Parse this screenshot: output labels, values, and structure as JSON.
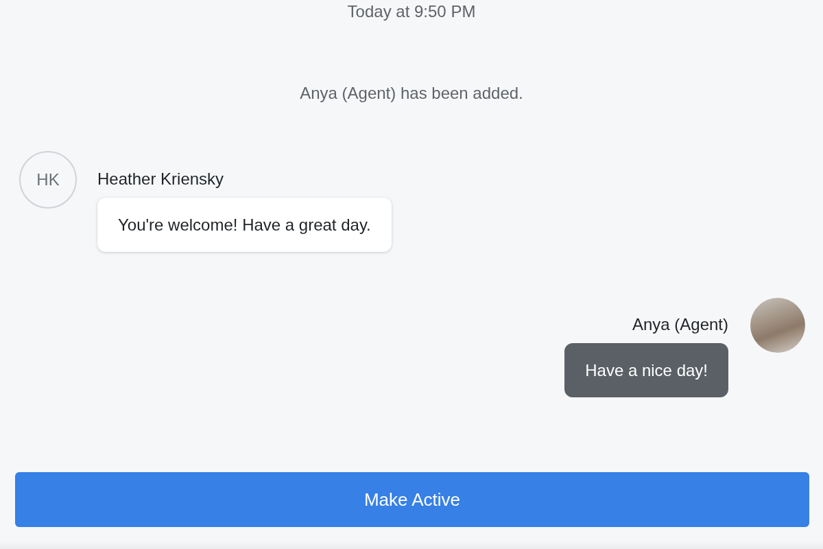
{
  "timestamp": "Today at 9:50 PM",
  "system_message": "Anya (Agent) has been added.",
  "messages": [
    {
      "kind": "incoming",
      "sender": "Heather Kriensky",
      "initials": "HK",
      "text": "You're welcome! Have a great day."
    },
    {
      "kind": "outgoing",
      "sender": "Anya (Agent)",
      "text": "Have a nice day!"
    }
  ],
  "button": {
    "label": "Make Active"
  }
}
